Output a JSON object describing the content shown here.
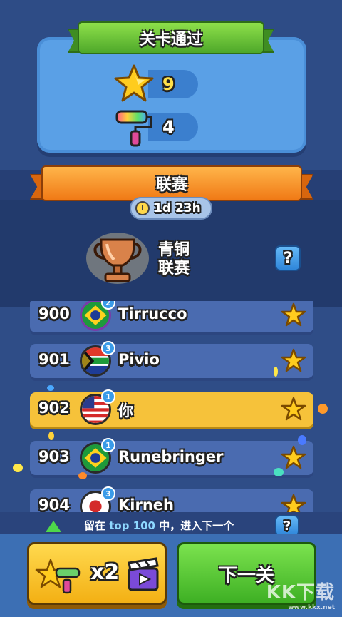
{
  "header": {
    "title": "关卡通过"
  },
  "rewards": [
    {
      "icon": "star-icon",
      "value": "9"
    },
    {
      "icon": "paint-roller-icon",
      "value": "4"
    }
  ],
  "league": {
    "title": "联赛",
    "timer": "1d 23h",
    "name_line1": "青铜",
    "name_line2": "联赛",
    "help": "?"
  },
  "leaderboard": [
    {
      "rank": "900",
      "name": "Tirrucco",
      "flag": "brazil",
      "level": "2",
      "is_me": false
    },
    {
      "rank": "901",
      "name": "Pivio",
      "flag": "south-africa",
      "level": "3",
      "is_me": false
    },
    {
      "rank": "902",
      "name": "你",
      "flag": "usa",
      "level": "1",
      "is_me": true
    },
    {
      "rank": "903",
      "name": "Runebringer",
      "flag": "brazil",
      "level": "1",
      "is_me": false
    },
    {
      "rank": "904",
      "name": "Kirneh",
      "flag": "japan",
      "level": "3",
      "is_me": false
    }
  ],
  "promotion": {
    "prefix": "留在 ",
    "highlight": "top 100",
    "suffix": " 中，进入下一个",
    "help": "?"
  },
  "buttons": {
    "double_label": "x2",
    "next_label": "下一关"
  },
  "watermark": {
    "main": "KK下载",
    "sub": "www.kkx.net"
  },
  "colors": {
    "gold_row": "#f6c23a",
    "blue_row": "#4a6bb0",
    "next_button": "#3eb024",
    "double_button": "#f3b014"
  }
}
